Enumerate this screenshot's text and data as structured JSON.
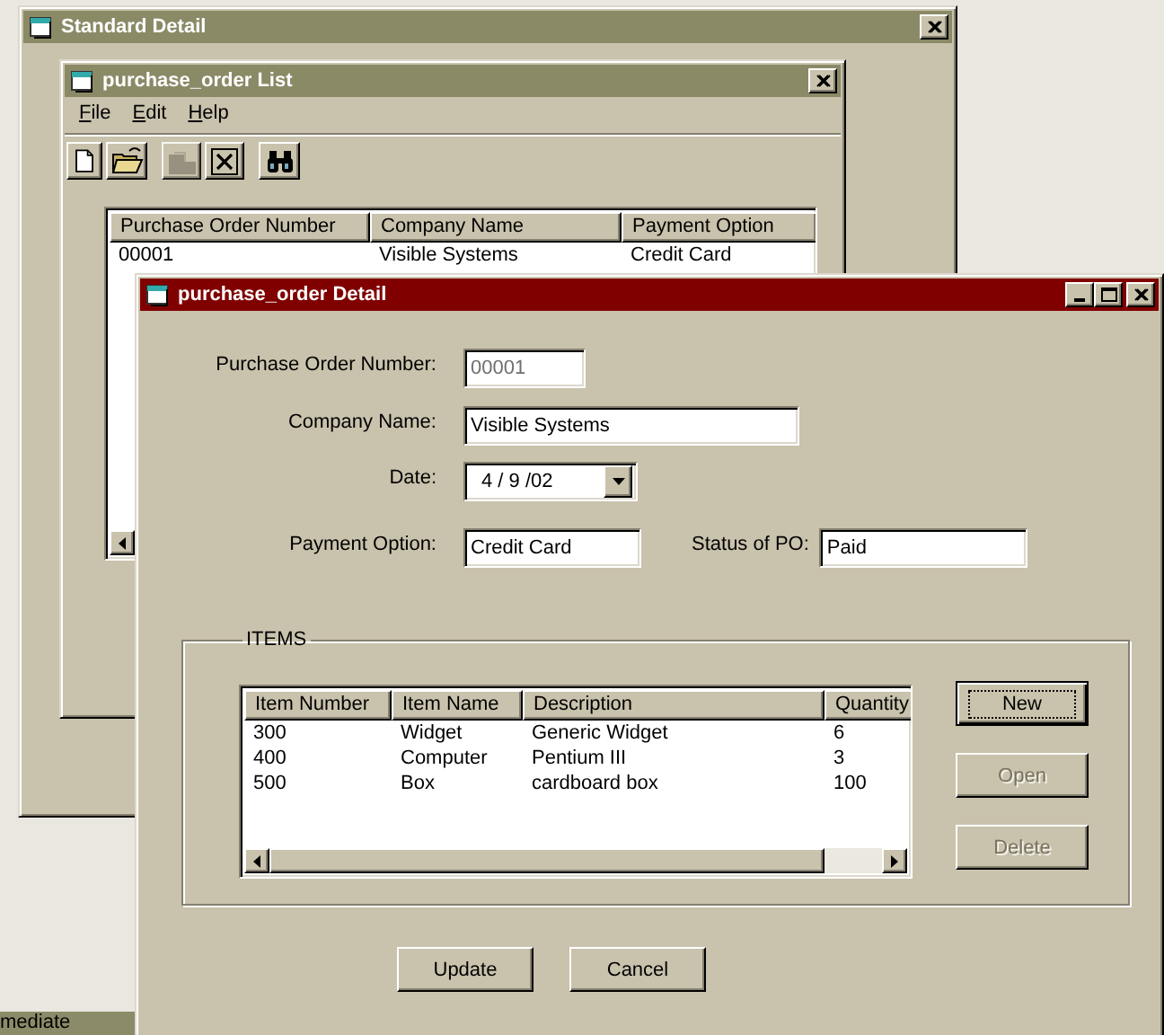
{
  "desktop": {
    "panel_title": "mediate"
  },
  "standard_window": {
    "title": "Standard Detail",
    "active": false
  },
  "list_window": {
    "title": "purchase_order List",
    "active": false,
    "menu": [
      {
        "label": "File"
      },
      {
        "label": "Edit"
      },
      {
        "label": "Help"
      }
    ],
    "toolbar": [
      {
        "kind": "new",
        "disabled": false
      },
      {
        "kind": "open",
        "disabled": false
      },
      {
        "kind": "separator"
      },
      {
        "kind": "paste",
        "disabled": true
      },
      {
        "kind": "delete",
        "disabled": false
      },
      {
        "kind": "separator"
      },
      {
        "kind": "find",
        "disabled": false
      }
    ],
    "table": {
      "columns": [
        "Purchase Order Number",
        "Company Name",
        "Payment Option"
      ],
      "rows": [
        [
          "00001",
          "Visible Systems",
          "Credit Card"
        ]
      ]
    }
  },
  "detail_window": {
    "title": "purchase_order Detail",
    "active": true,
    "form_rows": [
      {
        "fields": [
          {
            "label": "Purchase Order Number:",
            "value": "00001",
            "kind": "text",
            "disabled": true
          }
        ]
      },
      {
        "fields": [
          {
            "label": "Company Name:",
            "value": "Visible Systems",
            "kind": "text",
            "disabled": false
          }
        ]
      },
      {
        "fields": [
          {
            "label": "Date:",
            "value": "4 / 9 /02",
            "kind": "dropdown",
            "disabled": false
          }
        ]
      },
      {
        "fields": [
          {
            "label": "Payment Option:",
            "value": "Credit Card",
            "kind": "text",
            "disabled": false
          },
          {
            "label": "Status of PO:",
            "value": "Paid",
            "kind": "text",
            "disabled": false
          }
        ]
      }
    ],
    "items": {
      "title": "ITEMS",
      "table": {
        "columns": [
          "Item Number",
          "Item Name",
          "Description",
          "Quantity"
        ],
        "rows": [
          [
            "300",
            "Widget",
            "Generic Widget",
            "6"
          ],
          [
            "400",
            "Computer",
            "Pentium III",
            "3"
          ],
          [
            "500",
            "Box",
            "cardboard box",
            "100"
          ]
        ]
      },
      "buttons": [
        {
          "label": "New",
          "disabled": false,
          "focused": true
        },
        {
          "label": "Open",
          "disabled": true,
          "focused": false
        },
        {
          "label": "Delete",
          "disabled": true,
          "focused": false
        }
      ]
    },
    "buttons": [
      {
        "label": "Update",
        "disabled": false,
        "focused": false
      },
      {
        "label": "Cancel",
        "disabled": false,
        "focused": false
      }
    ]
  }
}
